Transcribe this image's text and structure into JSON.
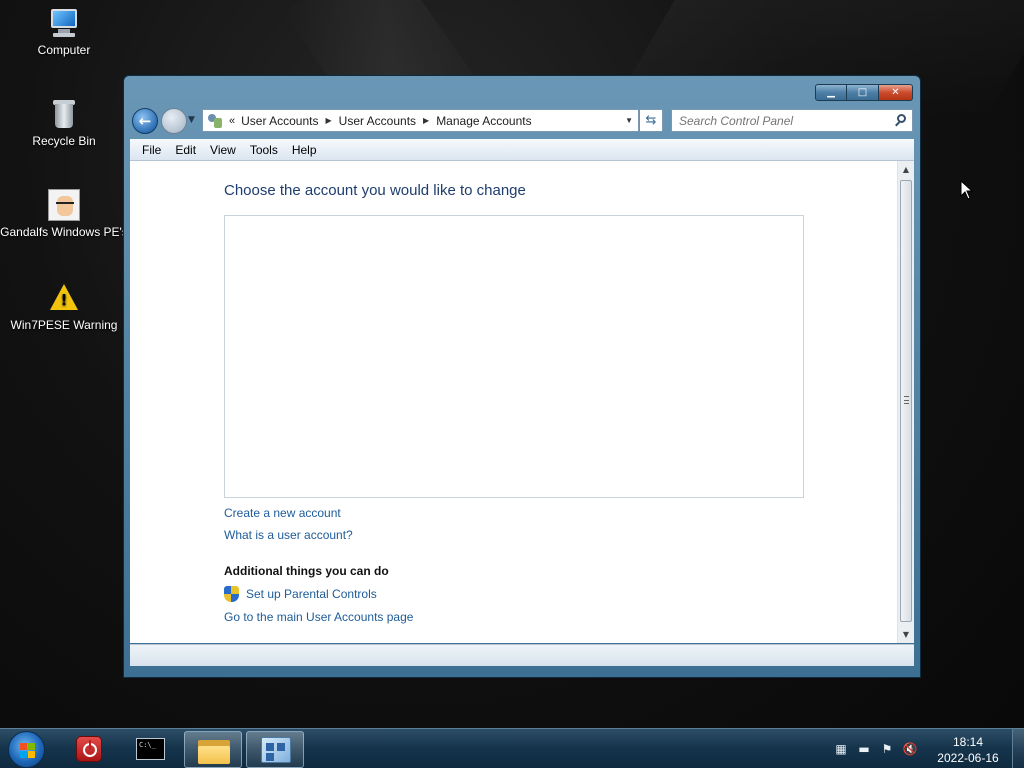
{
  "desktop": {
    "icons": [
      {
        "label": "Computer",
        "icon": "computer-icon"
      },
      {
        "label": "Recycle Bin",
        "icon": "recycle-bin-icon"
      },
      {
        "label": "Gandalfs Windows PE's",
        "icon": "avatar-icon"
      },
      {
        "label": "Win7PESE Warning",
        "icon": "warning-icon"
      }
    ]
  },
  "window": {
    "caption_buttons": {
      "minimize": "minimize",
      "maximize": "maximize",
      "close": "close"
    },
    "address": {
      "lead": "«",
      "crumbs": [
        "User Accounts",
        "User Accounts",
        "Manage Accounts"
      ]
    },
    "search": {
      "placeholder": "Search Control Panel"
    },
    "menu": [
      "File",
      "Edit",
      "View",
      "Tools",
      "Help"
    ],
    "content": {
      "title": "Choose the account you would like to change",
      "links": {
        "create_account": "Create a new account",
        "what_is_account": "What is a user account?"
      },
      "additional_heading": "Additional things you can do",
      "parental_controls": "Set up Parental Controls",
      "main_page": "Go to the main User Accounts page"
    }
  },
  "taskbar": {
    "clock": {
      "time": "18:14",
      "date": "2022-06-16"
    },
    "cmd_text": "C:\\_",
    "colors": {
      "accent": "#15344c",
      "link": "#1e5c99",
      "title": "#1e3d6e"
    }
  }
}
